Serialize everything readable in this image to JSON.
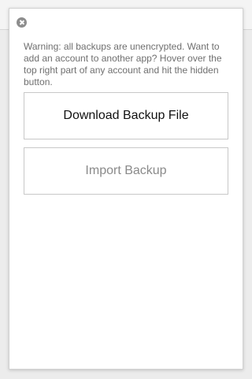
{
  "popup": {
    "close_icon": "close-circle-icon",
    "warning_text": "Warning: all backups are unencrypted. Want to add an account to another app? Hover over the top right part of any account and hit the hidden button.",
    "download_button_label": "Download Backup File",
    "import_button_label": "Import Backup"
  },
  "colors": {
    "panel_background": "#ffffff",
    "page_background": "#ececec",
    "warning_text": "#6f6f6f",
    "primary_button_text": "#111111",
    "secondary_button_text": "#8a8a8a",
    "button_border": "#c8c8c8",
    "close_icon": "#8d8d8d"
  }
}
